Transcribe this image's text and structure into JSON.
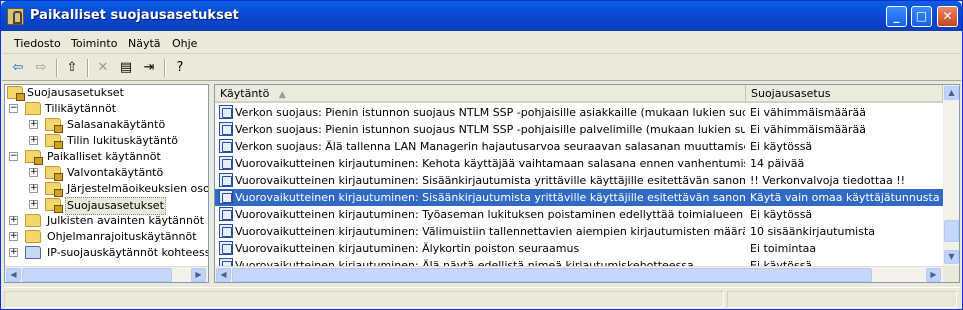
{
  "window": {
    "title": "Paikalliset suojausasetukset"
  },
  "menu": [
    {
      "label": "Tiedosto"
    },
    {
      "label": "Toiminto"
    },
    {
      "label": "Näytä"
    },
    {
      "label": "Ohje"
    }
  ],
  "tree": {
    "root": "Suojausasetukset",
    "items": [
      {
        "label": "Tilikäytännöt"
      },
      {
        "label": "Salasanakäytäntö"
      },
      {
        "label": "Tilin lukituskäytäntö"
      },
      {
        "label": "Paikalliset käytännöt"
      },
      {
        "label": "Valvontakäytäntö"
      },
      {
        "label": "Järjestelmäoikeuksien osoitus"
      },
      {
        "label": "Suojausasetukset"
      },
      {
        "label": "Julkisten avainten käytännöt"
      },
      {
        "label": "Ohjelmanrajoituskäytännöt"
      },
      {
        "label": "IP-suojauskäytännöt kohteessa P"
      }
    ]
  },
  "list": {
    "columns": {
      "policy": "Käytäntö",
      "setting": "Suojausasetus"
    },
    "rows": [
      {
        "policy": "Verkon suojaus: Pienin istunnon suojaus NTLM SSP -pohjaisille asiakkaille (mukaan lukien suojattu RPC -...",
        "setting": "Ei vähimmäismäärää"
      },
      {
        "policy": "Verkon suojaus: Pienin istunnon suojaus NTLM SSP -pohjaisille palvelimille (mukaan lukien suojattu RCP -...",
        "setting": "Ei vähimmäismäärää"
      },
      {
        "policy": "Verkon suojaus: Älä tallenna LAN Managerin hajautusarvoa seuraavan salasanan muuttamisen yhteyde...",
        "setting": "Ei käytössä"
      },
      {
        "policy": "Vuorovaikutteinen kirjautuminen: Kehota käyttäjää vaihtamaan salasana ennen vanhentumista",
        "setting": "14 päivää"
      },
      {
        "policy": "Vuorovaikutteinen kirjautuminen: Sisäänkirjautumista yrittäville käyttäjille esitettävän sanoman otsikko",
        "setting": "!! Verkonvalvoja tiedottaa !!"
      },
      {
        "policy": "Vuorovaikutteinen kirjautuminen: Sisäänkirjautumista yrittäville käyttäjille esitettävän sanoman teksti",
        "setting": "Käytä vain omaa käyttäjätunnusta ja s..."
      },
      {
        "policy": "Vuorovaikutteinen kirjautuminen: Työaseman lukituksen poistaminen edellyttää toimialueen ohjauskone...",
        "setting": "Ei käytössä"
      },
      {
        "policy": "Vuorovaikutteinen kirjautuminen: Välimuistiin tallennettavien aiempien kirjautumisten määrä (siltä varalt...",
        "setting": "10 sisäänkirjautumista"
      },
      {
        "policy": "Vuorovaikutteinen kirjautuminen: Älykortin poiston seuraamus",
        "setting": "Ei toimintaa"
      },
      {
        "policy": "Vuorovaikutteinen kirjautuminen: Älä näytä edellistä nimeä kirjautumiskehotteessa",
        "setting": "Ei käytössä"
      }
    ],
    "selected_index": 5
  }
}
